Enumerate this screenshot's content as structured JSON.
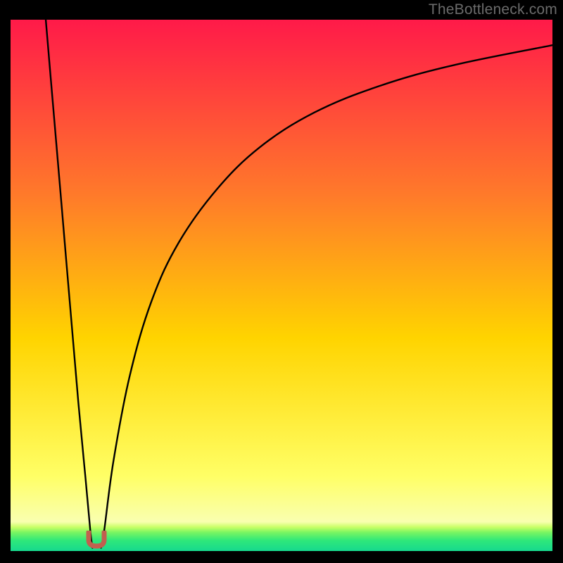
{
  "watermark": "TheBottleneck.com",
  "colors": {
    "gradient_top": "#ff1a49",
    "gradient_mid1": "#ff7a2a",
    "gradient_mid2": "#ffd400",
    "gradient_low": "#ffff66",
    "gradient_pale": "#f9ffb0",
    "band_yellowgreen": "#c8ff66",
    "band_green1": "#79f562",
    "band_green2": "#2fe87a",
    "band_green3": "#17d98e",
    "curve": "#000000",
    "marker": "#c1604f",
    "frame": "#000000"
  },
  "chart_data": {
    "type": "line",
    "title": "",
    "xlabel": "",
    "ylabel": "",
    "x_range": [
      0,
      100
    ],
    "y_range": [
      0,
      100
    ],
    "notes": "V-shaped bottleneck curve. Values are percentage coordinates estimated from the pixel plot. Left branch is near-linear, right branch is concave. Minimum near x≈15, y≈0. A small U-shaped red marker sits at the minimum.",
    "series": [
      {
        "name": "left_branch",
        "points": [
          {
            "x": 6.5,
            "y": 100
          },
          {
            "x": 8,
            "y": 82
          },
          {
            "x": 9.5,
            "y": 64
          },
          {
            "x": 11,
            "y": 46
          },
          {
            "x": 12.5,
            "y": 28
          },
          {
            "x": 13.8,
            "y": 14
          },
          {
            "x": 14.7,
            "y": 4
          },
          {
            "x": 15.1,
            "y": 0.6
          }
        ]
      },
      {
        "name": "right_branch",
        "points": [
          {
            "x": 16.7,
            "y": 0.6
          },
          {
            "x": 17.3,
            "y": 4
          },
          {
            "x": 19,
            "y": 17
          },
          {
            "x": 22,
            "y": 33
          },
          {
            "x": 26,
            "y": 47
          },
          {
            "x": 31,
            "y": 58
          },
          {
            "x": 38,
            "y": 68
          },
          {
            "x": 46,
            "y": 76
          },
          {
            "x": 56,
            "y": 82.5
          },
          {
            "x": 68,
            "y": 87.5
          },
          {
            "x": 82,
            "y": 91.5
          },
          {
            "x": 100,
            "y": 95.2
          }
        ]
      }
    ],
    "marker": {
      "x": 15.9,
      "y": 1.4,
      "shape": "u",
      "color": "#c1604f"
    }
  }
}
